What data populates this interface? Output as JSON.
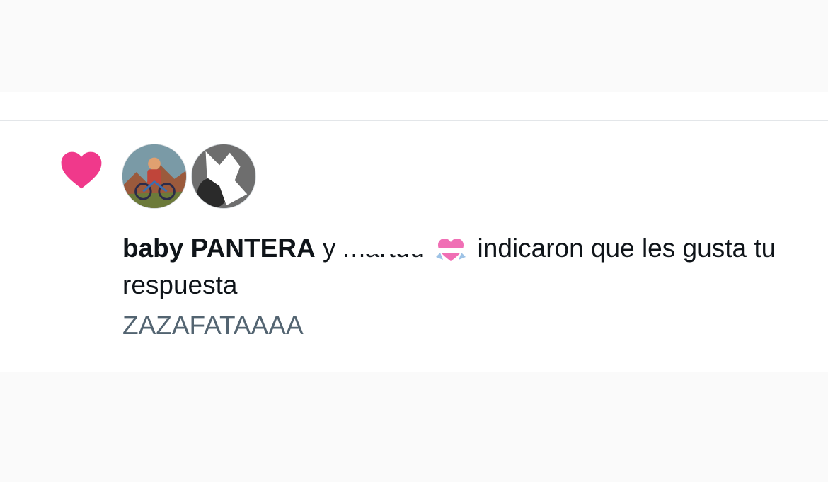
{
  "notification": {
    "type_icon": "heart-icon",
    "heart_color": "#f0398b",
    "avatars": [
      {
        "name": "avatar-baby-pantera"
      },
      {
        "name": "avatar-martuu"
      }
    ],
    "liker_one": "baby PANTERA",
    "conjunction": "y",
    "liker_two": "martuu",
    "liker_two_emoji": "heart-with-ribbon-emoji",
    "message_rest": "indicaron que les gusta tu respuesta",
    "reply_text": "ZAZAFATAAAA"
  },
  "colors": {
    "primary_text": "#0f1419",
    "secondary_text": "#536471",
    "divider": "#e3e6e9"
  }
}
